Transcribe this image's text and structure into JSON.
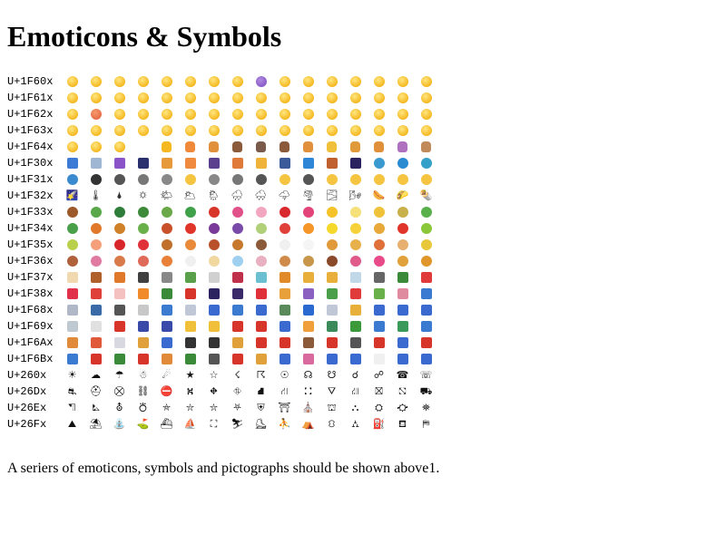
{
  "title": "Emoticons & Symbols",
  "note": "A seriers of emoticons, symbols and pictographs should be shown above1.",
  "rows": [
    {
      "label": "U+1F60x",
      "glyphs": "😀😁😂😃😄😅😆😇😈😉😊😋😌😍😎😏"
    },
    {
      "label": "U+1F61x",
      "glyphs": "😐😑😒😓😔😕😖😗😘😙😚😛😜😝😞😟"
    },
    {
      "label": "U+1F62x",
      "glyphs": "😠😡😢😣😤😥😦😧😨😩😪😫😬😭😮😯"
    },
    {
      "label": "U+1F63x",
      "glyphs": "😰😱😲😳😴😵😶😷😸😹😺😻😼😽😾😿"
    },
    {
      "label": "U+1F64x",
      "glyphs": "🙀🙁🙂🙃🙄🙅🙆🙇🙈🙉🙊🙋🙌🙍🙎🙏"
    },
    {
      "label": "U+1F30x",
      "glyphs": "🌀🌁🌂🌃🌄🌅🌆🌇🌈🌉🌊🌋🌌🌍🌎🌏"
    },
    {
      "label": "U+1F31x",
      "glyphs": "🌐🌑🌒🌓🌔🌕🌖🌗🌘🌙🌚🌛🌜🌝🌞🌟"
    },
    {
      "label": "U+1F32x",
      "glyphs": "🌠🌡🌢🌣🌤🌥🌦🌧🌨🌩🌪🌫🌬🌭🌮🌯"
    },
    {
      "label": "U+1F33x",
      "glyphs": "🌰🌱🌲🌳🌴🌵🌶🌷🌸🌹🌺🌻🌼🌽🌾🌿"
    },
    {
      "label": "U+1F34x",
      "glyphs": "🍀🍁🍂🍃🍄🍅🍆🍇🍈🍉🍊🍋🍌🍍🍎🍏"
    },
    {
      "label": "U+1F35x",
      "glyphs": "🍐🍑🍒🍓🍔🍕🍖🍗🍘🍙🍚🍛🍜🍝🍞🍟"
    },
    {
      "label": "U+1F36x",
      "glyphs": "🍠🍡🍢🍣🍤🍥🍦🍧🍨🍩🍪🍫🍬🍭🍮🍯"
    },
    {
      "label": "U+1F37x",
      "glyphs": "🍰🍱🍲🍳🍴🍵🍶🍷🍸🍹🍺🍻🍼🍽🍾🍿"
    },
    {
      "label": "U+1F38x",
      "glyphs": "🎀🎁🎂🎃🎄🎅🎆🎇🎈🎉🎊🎋🎌🎍🎎🎏"
    },
    {
      "label": "U+1F68x",
      "glyphs": "🚀🚁🚂🚃🚄🚅🚆🚇🚈🚉🚊🚋🚌🚍🚎🚏"
    },
    {
      "label": "U+1F69x",
      "glyphs": "🚐🚑🚒🚓🚔🚕🚖🚗🚘🚙🚚🚛🚜🚝🚞🚟"
    },
    {
      "label": "U+1F6Ax",
      "glyphs": "🚠🚡🚢🚣🚤🚥🚦🚧🚨🚩🚪🚫🚬🚭🚮🚯"
    },
    {
      "label": "U+1F6Bx",
      "glyphs": "🚰🚱🚲🚳🚴🚵🚶🚷🚸🚹🚺🚻🚼🚽🚾🚿"
    },
    {
      "label": "U+260x",
      "glyphs": "☀☁☂☃☄★☆☇☈☉☊☋☌☍☎☏"
    },
    {
      "label": "U+26Dx",
      "glyphs": "⛐⛑⛒⛓⛔⛕⛖⛗⛘⛙⛚⛛⛜⛝⛞⛟"
    },
    {
      "label": "U+26Ex",
      "glyphs": "⛠⛡⛢⛣⛤⛥⛦⛧⛨⛩⛪⛫⛬⛭⛮⛯"
    },
    {
      "label": "U+26Fx",
      "glyphs": "⛰⛱⛲⛳⛴⛵⛶⛷⛸⛹⛺⛻⛼⛽⛾⛿"
    }
  ]
}
